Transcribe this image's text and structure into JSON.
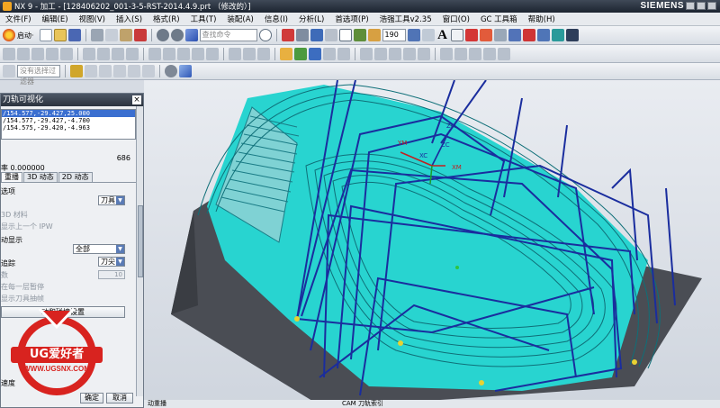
{
  "window": {
    "title": "NX 9 - 加工 - [128406202_001-3-5-RST-2014.4.9.prt （修改的）]",
    "brand": "SIEMENS"
  },
  "menu": [
    "文件(F)",
    "编辑(E)",
    "视图(V)",
    "插入(S)",
    "格式(R)",
    "工具(T)",
    "装配(A)",
    "信息(I)",
    "分析(L)",
    "首选项(P)",
    "浩强工具v2.35",
    "窗口(O)",
    "GC 工具箱",
    "帮助(H)"
  ],
  "toolbar": {
    "start_label": "启动·",
    "command_search_placeholder": "查找命令",
    "zoom_value": "190",
    "filter_placeholder": "没有选择过滤器",
    "icon_names": [
      "start-icon",
      "new-icon",
      "open-icon",
      "save-icon",
      "cut-icon",
      "copy-icon",
      "paste-icon",
      "undo-icon",
      "redo-icon",
      "cube-icon",
      "search-icon",
      "fit-icon",
      "zoom-icon",
      "orient-icon",
      "shade-icon",
      "layer-icon",
      "wcs-icon",
      "measure-icon",
      "text-icon",
      "grid-icon",
      "snap-icon",
      "color-icon",
      "display-icon",
      "move-icon",
      "window-icon"
    ]
  },
  "dialog": {
    "title": "刀轨可视化",
    "path_lines": [
      "/154.577,-29.427,25.000",
      "/154.577,-29.427,-4.700",
      "/154.575,-29.420,-4.963"
    ],
    "count": "686",
    "rate_label": "率 0.000000",
    "tabs": [
      "重播",
      "3D 动态",
      "2D 动态"
    ],
    "active_tab": "重播",
    "display_options_label": "选项",
    "tool_select": "刀具",
    "show_3d_material": "3D 材料",
    "show_prev_ipw": "显示上一个 IPW",
    "motion_display_label": "动显示",
    "motion_select": "全部",
    "trace_label": "追踪",
    "trace_select": "刀尖",
    "count_label": "数",
    "count_value": "10",
    "pause_each": "在每一层暂停",
    "show_tool_jerk": "显示刀具抽帧",
    "settings_button": "动和碰撞设置",
    "speed_label": "速度",
    "ok_label": "确定",
    "cancel_label": "取消"
  },
  "viewport": {
    "axis_labels": [
      "ZM",
      "ZC",
      "XC",
      "YM",
      "XM"
    ]
  },
  "logo": {
    "text": "UG爱好者",
    "url": "WWW.UGSNX.COM"
  },
  "bottombar": {
    "left_text": "动重播",
    "right_text": "CAM 刀轨索引"
  },
  "colors": {
    "toolpath": "#1a2d9e",
    "surface": "#28d4d0",
    "block": "#4a4d54",
    "logo_red": "#d8231f"
  }
}
